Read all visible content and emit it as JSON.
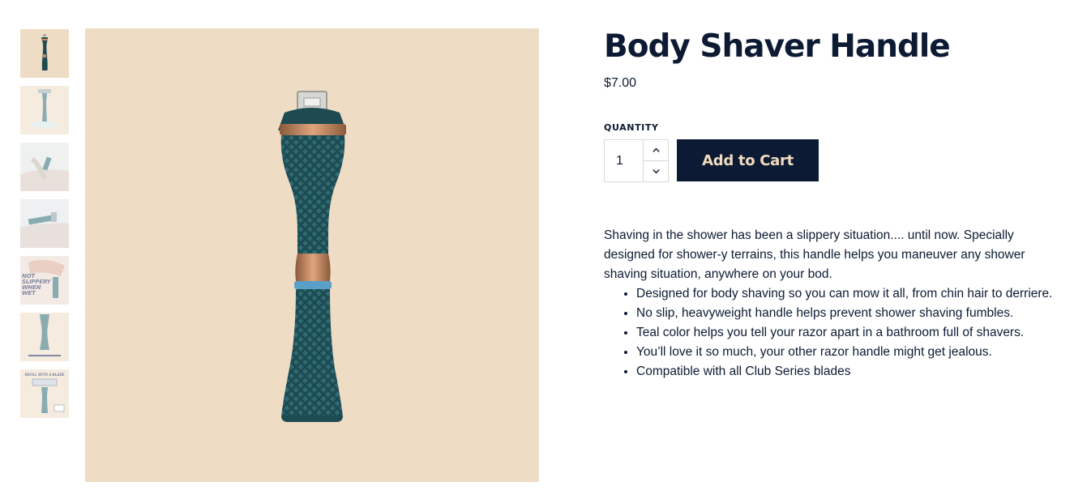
{
  "product": {
    "title": "Body Shaver Handle",
    "price": "$7.00"
  },
  "quantity": {
    "label": "QUANTITY",
    "value": "1",
    "increment_icon": "chevron-up-icon",
    "decrement_icon": "chevron-down-icon"
  },
  "cart": {
    "button_label": "Add to Cart"
  },
  "description": {
    "intro": "Shaving in the shower has been a slippery situation.... until now. Specially designed for shower-y terrains, this handle helps you maneuver any shower shaving situation, anywhere on your bod.",
    "bullets": [
      "Designed for body shaving so you can mow it all, from chin hair to derriere.",
      "No slip, heavyweight handle helps prevent shower shaving fumbles.",
      "Teal color helps you tell your razor apart in a bathroom full of shavers.",
      "You’ll love it so much, your other razor handle might get jealous.",
      "Compatible with all Club Series blades"
    ]
  },
  "gallery": {
    "thumb4_text": "NOT SLIPPERY WHEN WET",
    "thumb6_text": "REFILL WITH 4-BLADE"
  },
  "colors": {
    "navy": "#0c1b33",
    "beige": "#eedcc5",
    "teal": "#1f4b53",
    "copper": "#c98a5c",
    "button_text": "#f1dcc0"
  }
}
